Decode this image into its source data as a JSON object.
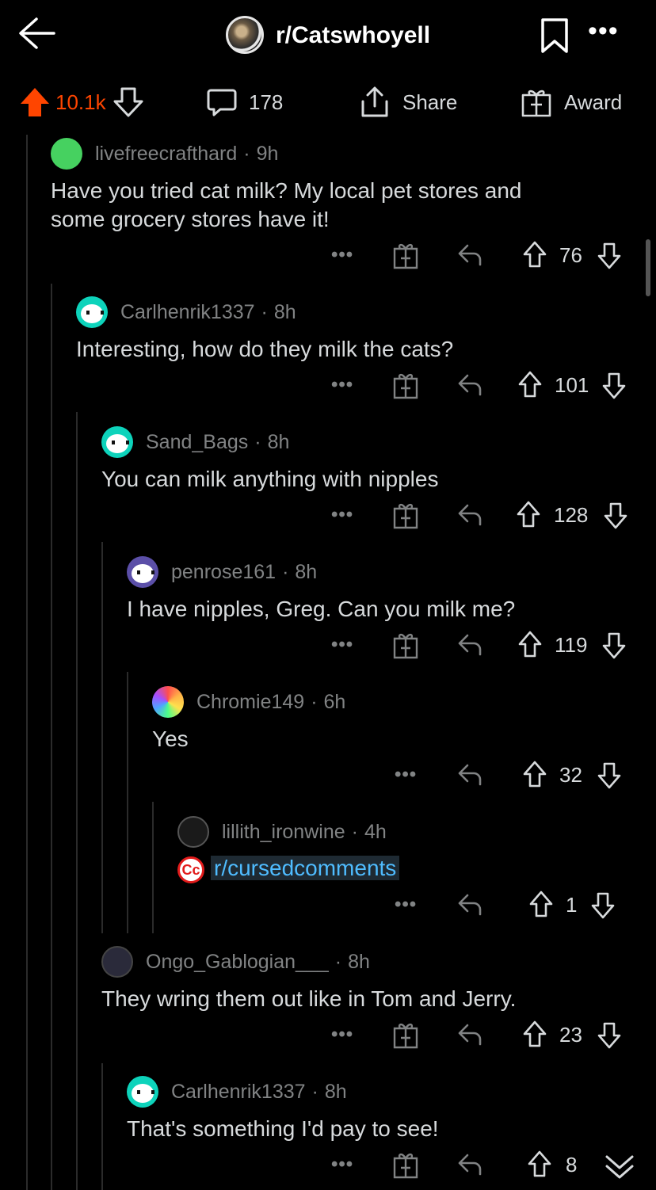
{
  "header": {
    "subreddit": "r/Catswhoyell",
    "icons": {
      "back": "back-arrow-icon",
      "bookmark": "bookmark-icon",
      "more": "more-icon"
    }
  },
  "post_bar": {
    "votes": "10.1k",
    "comments": "178",
    "share_label": "Share",
    "award_label": "Award",
    "accent": "#ff4500"
  },
  "comments": [
    {
      "user": "livefreecrafthard",
      "time": "9h",
      "lines": [
        "Have you tried cat milk? My local pet stores and",
        "some grocery stores have it!"
      ],
      "score": "76"
    },
    {
      "user": "Carlhenrik1337",
      "time": "8h",
      "lines": [
        "Interesting, how do they milk the cats?"
      ],
      "score": "101"
    },
    {
      "user": "Sand_Bags",
      "time": "8h",
      "lines": [
        "You can milk anything with nipples"
      ],
      "score": "128"
    },
    {
      "user": "penrose161",
      "time": "8h",
      "lines": [
        "I have nipples, Greg. Can you milk me?"
      ],
      "score": "119"
    },
    {
      "user": "Chromie149",
      "time": "6h",
      "lines": [
        "Yes"
      ],
      "score": "32"
    },
    {
      "user": "lillith_ironwine",
      "time": "4h",
      "link": "r/cursedcomments",
      "score": "1"
    },
    {
      "user": "Ongo_Gablogian___",
      "time": "8h",
      "lines": [
        "They wring them out like in Tom and Jerry."
      ],
      "score": "23"
    },
    {
      "user": "Carlhenrik1337",
      "time": "8h",
      "lines": [
        "That's something I'd pay to see!"
      ],
      "score": "8"
    }
  ],
  "separator": "·",
  "more_glyph": "•••"
}
